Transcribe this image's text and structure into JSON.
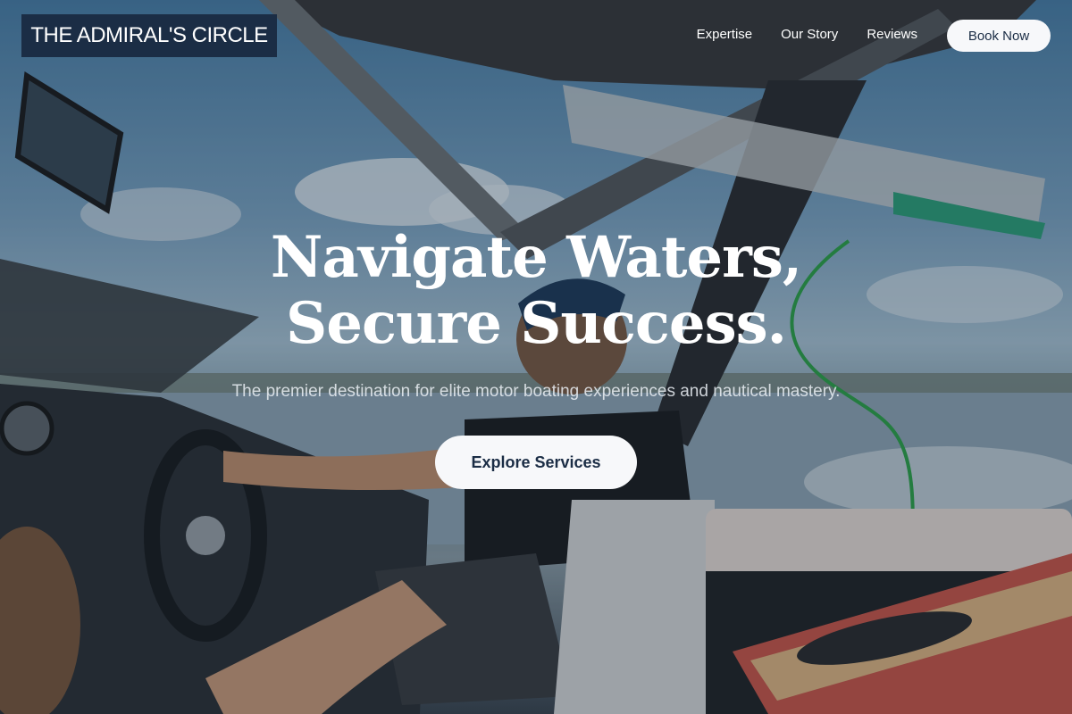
{
  "nav": {
    "logo": "THE ADMIRAL'S CIRCLE",
    "links": [
      "Expertise",
      "Our Story",
      "Reviews"
    ],
    "book_label": "Book Now"
  },
  "hero": {
    "headline_line1": "Navigate Waters,",
    "headline_line2": "Secure Success.",
    "subheadline": "The premier destination for elite motor boating experiences and nautical mastery.",
    "cta_label": "Explore Services"
  }
}
